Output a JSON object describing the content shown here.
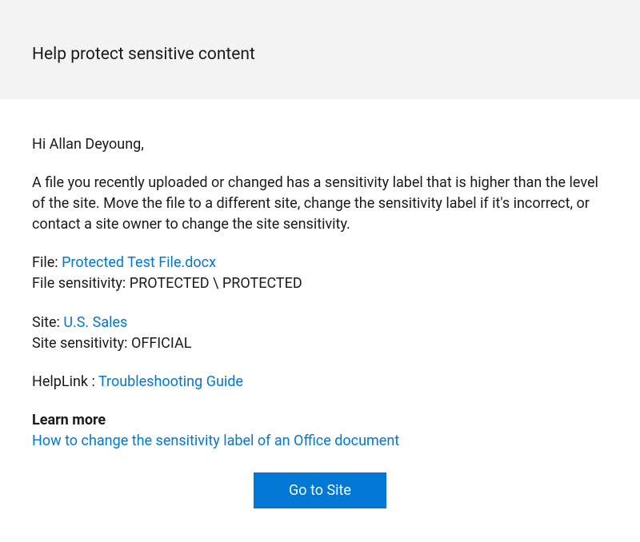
{
  "header": {
    "title": "Help protect sensitive content"
  },
  "body": {
    "greeting": "Hi Allan Deyoung,",
    "description": "A file you recently uploaded or changed has a sensitivity label that is higher than the level of the site. Move the file to a different site, change the sensitivity label if it's incorrect, or contact a site owner to change the site sensitivity.",
    "file_label": "File: ",
    "file_link": "Protected Test File.docx",
    "file_sensitivity_label": "File sensitivity: ",
    "file_sensitivity_value": "PROTECTED \\ PROTECTED",
    "site_label": "Site: ",
    "site_link": "U.S. Sales",
    "site_sensitivity_label": "Site sensitivity: ",
    "site_sensitivity_value": "OFFICIAL",
    "helplink_label": "HelpLink : ",
    "helplink_link": "Troubleshooting Guide",
    "learn_more": "Learn more",
    "learn_more_link": "How to change the sensitivity label of an Office document",
    "button_label": "Go to Site"
  }
}
